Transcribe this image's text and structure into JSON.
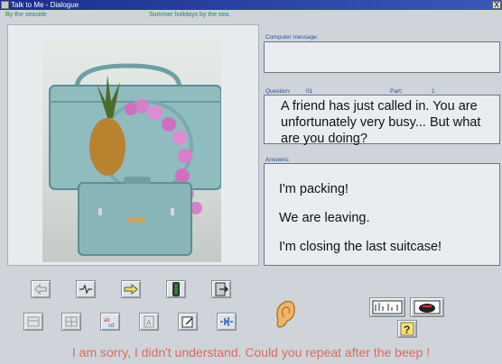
{
  "window": {
    "title": "Talk to Me - Dialogue",
    "close_label": "X"
  },
  "header": {
    "left": "By the seaside",
    "center": "Summer holidays by the sea."
  },
  "computer_message": {
    "label": "Computer message:",
    "text": ""
  },
  "question": {
    "label": "Question:",
    "number": "01",
    "part_label": "Part:",
    "part": "1",
    "text": "A friend has just called in. You are unfortunately very busy... But what are you doing?"
  },
  "answers": {
    "label": "Answers:",
    "items": [
      "I'm packing!",
      "We are leaving.",
      "I'm closing the last suitcase!"
    ]
  },
  "status_message": "I am sorry, I didn't understand. Could you repeat after the beep !",
  "toolbar": {
    "row1": [
      "previous-icon",
      "record-icon",
      "next-icon",
      "traffic-light-icon",
      "exit-icon"
    ],
    "row2": [
      "view-icon",
      "grid-icon",
      "alphabet-icon",
      "font-icon",
      "edit-icon",
      "waveform-icon"
    ],
    "right": [
      "phonetic-icon",
      "speaker-icon",
      "help-icon"
    ],
    "ear": "ear-icon"
  },
  "colors": {
    "accent": "#2c4f9c",
    "error": "#e2685e",
    "header_text": "#2b8a4a"
  }
}
